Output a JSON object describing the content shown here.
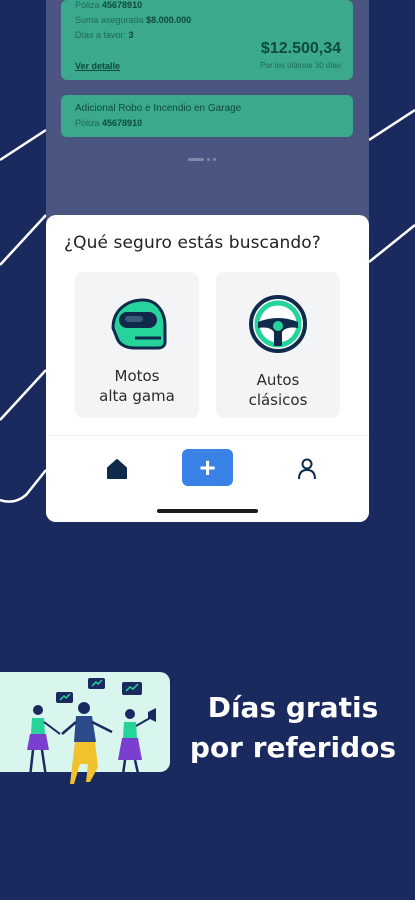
{
  "policy_card": {
    "policy_label": "Póliza",
    "policy_number": "45678910",
    "sum_label": "Suma asegurada",
    "sum_value": "$8.000.000",
    "days_label": "Días a favor:",
    "days_value": "3",
    "detail_link": "Ver detalle",
    "amount": "$12.500,34",
    "amount_caption": "Por los últimos 30 días"
  },
  "extra_card": {
    "title": "Adicional Robo e Incendio en Garage",
    "policy_label": "Póliza",
    "policy_number": "45678910"
  },
  "panel": {
    "question": "¿Qué seguro estás buscando?",
    "options": [
      {
        "line1": "Motos",
        "line2": "alta gama",
        "icon": "motorcycle-helmet-icon"
      },
      {
        "line1": "Autos",
        "line2": "clásicos",
        "icon": "steering-wheel-icon"
      }
    ]
  },
  "tabbar": {
    "plus": "+",
    "icons": [
      "home-icon",
      "plus-icon",
      "user-icon"
    ]
  },
  "promo": {
    "line1": "Días gratis",
    "line2": "por referidos"
  },
  "colors": {
    "background": "#1b2a5e",
    "accent_green": "#25d39b",
    "accent_blue": "#3b82e6",
    "promo_bg": "#d8f6ee"
  }
}
